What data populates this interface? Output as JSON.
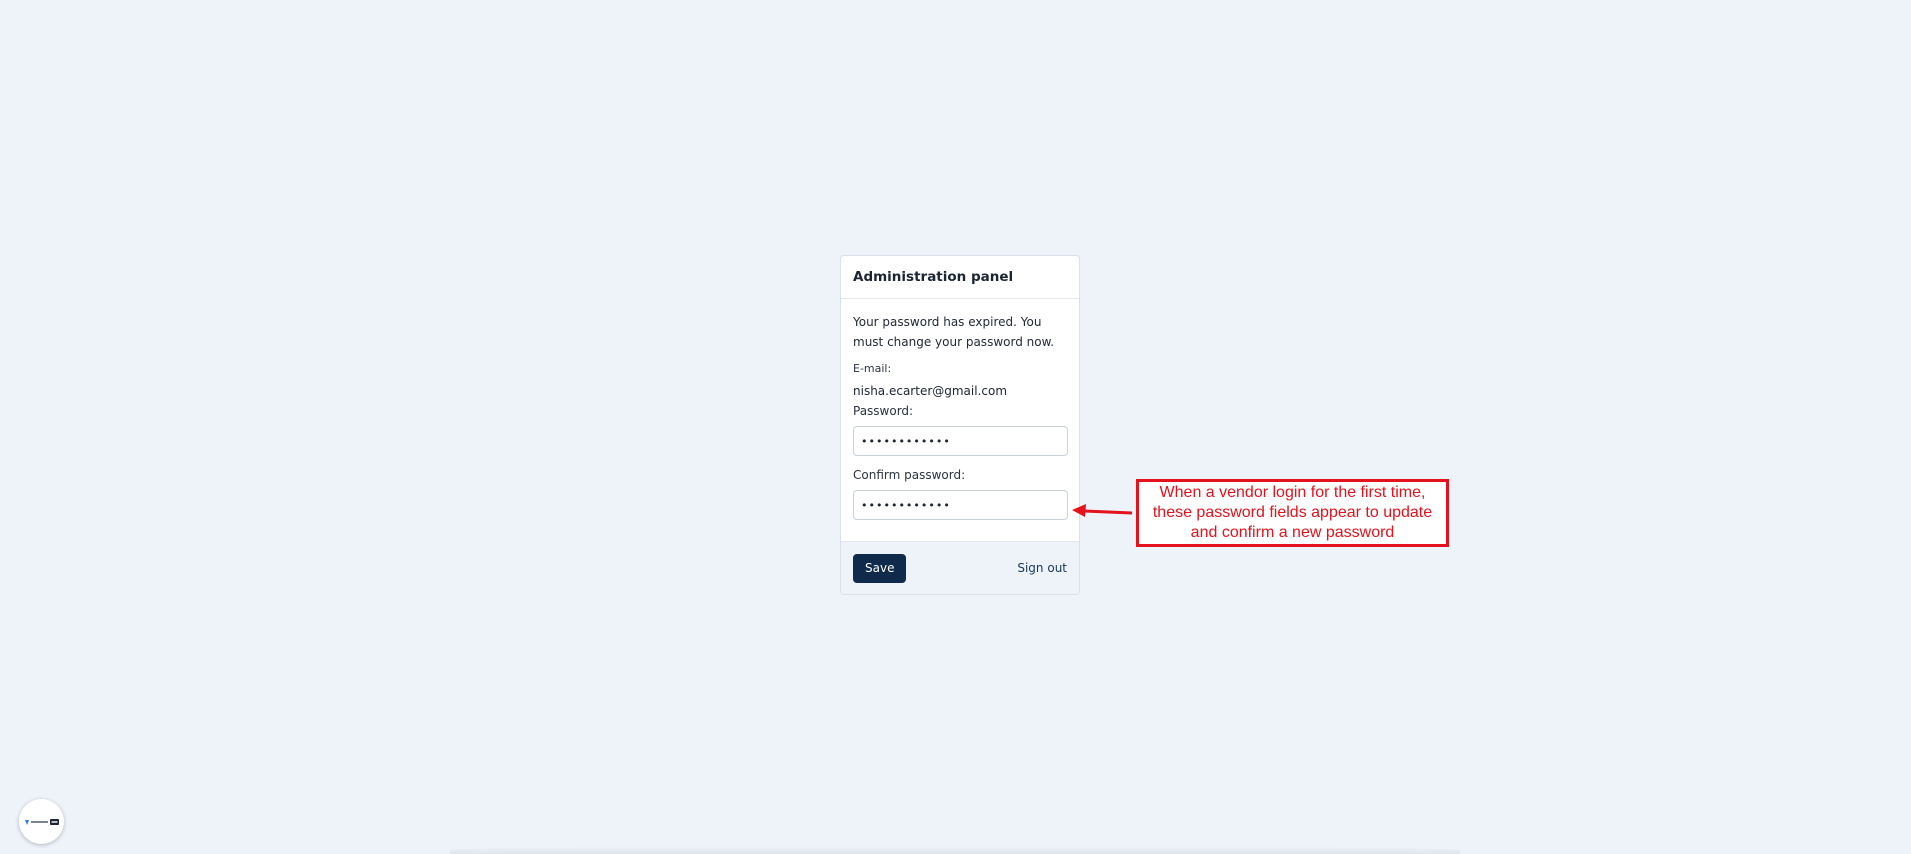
{
  "panel": {
    "title": "Administration panel",
    "notice": "Your password has expired. You must change your password now.",
    "email_label": "E-mail:",
    "email_value": "nisha.ecarter@gmail.com",
    "password_label": "Password:",
    "password_value": "••••••••••••",
    "confirm_label": "Confirm password:",
    "confirm_value": "••••••••••••",
    "save_label": "Save",
    "signout_label": "Sign out"
  },
  "annotation": {
    "text": "When a vendor login for the first time, these password fields appear to update and confirm a new password",
    "color": "#e3121c"
  },
  "widget": {
    "icon": "app-logo-icon"
  },
  "colors": {
    "background": "#eef3fa",
    "primary_button": "#0f2a4a",
    "link": "#17365d"
  }
}
